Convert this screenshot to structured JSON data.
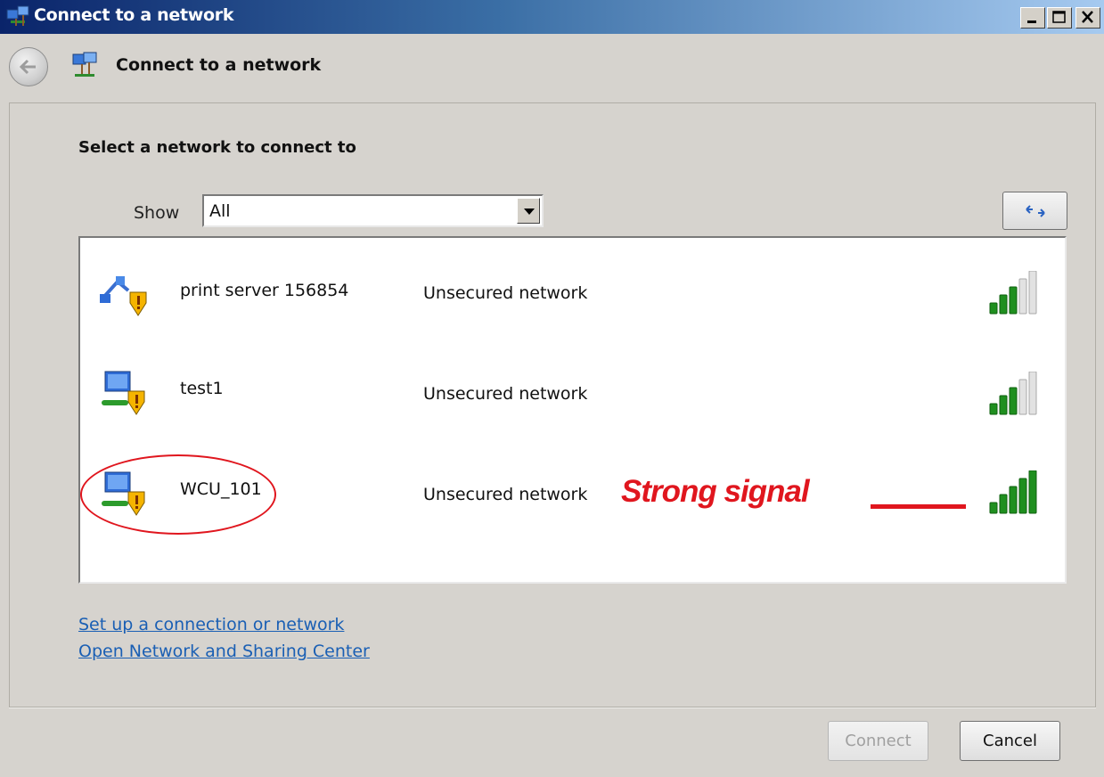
{
  "window": {
    "title": "Connect to a network"
  },
  "header": {
    "title": "Connect to a network"
  },
  "main": {
    "section_title": "Select a network to connect to",
    "filter": {
      "label": "Show",
      "selected": "All"
    },
    "networks": [
      {
        "name": "print server 156854",
        "status": "Unsecured network",
        "icon": "adhoc-network-icon",
        "signal_bars": 3,
        "signal_max": 5
      },
      {
        "name": "test1",
        "status": "Unsecured network",
        "icon": "wireless-network-icon",
        "signal_bars": 3,
        "signal_max": 5
      },
      {
        "name": "WCU_101",
        "status": "Unsecured network",
        "icon": "wireless-network-icon",
        "signal_bars": 5,
        "signal_max": 5
      }
    ],
    "annotation": {
      "text": "Strong signal",
      "color": "#e0161e"
    }
  },
  "links": {
    "setup": "Set up a connection or network",
    "sharing_center": "Open Network and Sharing Center"
  },
  "buttons": {
    "connect": "Connect",
    "cancel": "Cancel"
  },
  "colors": {
    "signal_on": "#1f8f1f",
    "signal_off": "#e2e2e2",
    "link": "#1a5fb4"
  }
}
